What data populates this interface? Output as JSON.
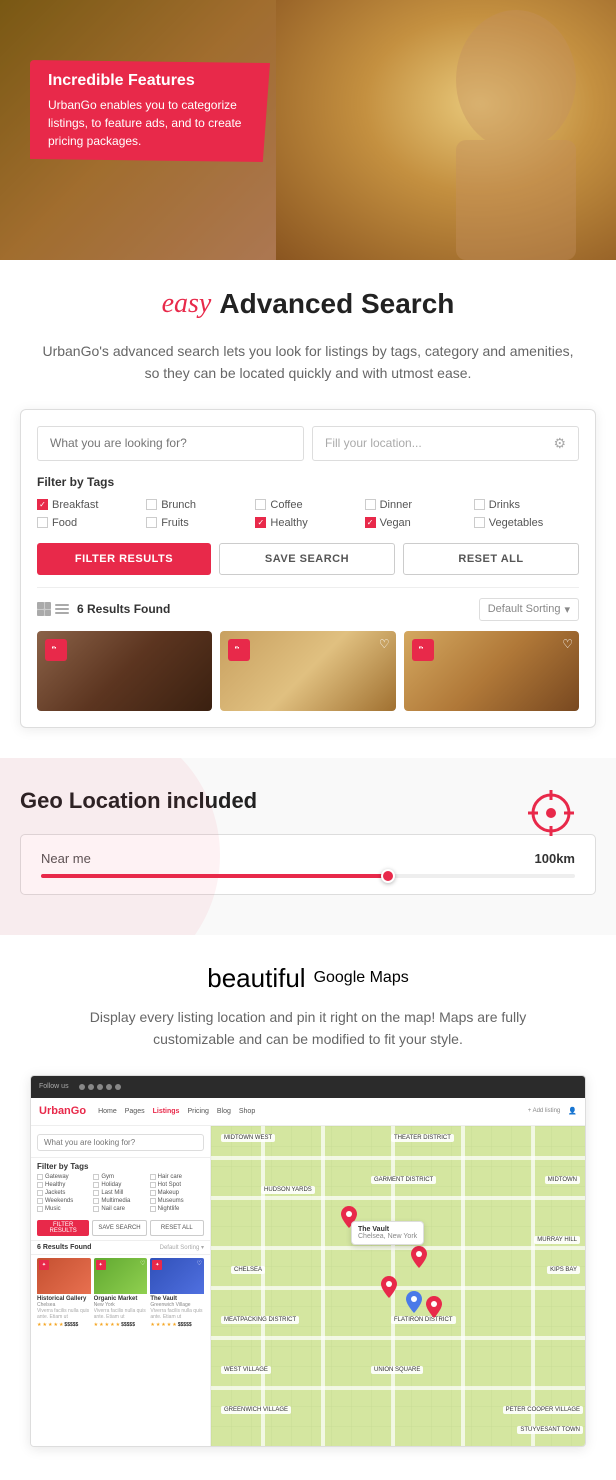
{
  "hero": {
    "badge_title": "Incredible Features",
    "badge_text": "UrbanGo enables you to categorize listings, to feature ads, and to create pricing packages."
  },
  "advanced_search": {
    "section_script": "easy",
    "section_title": "Advanced Search",
    "subtitle": "UrbanGo's advanced search lets you look for listings by tags, category and amenities, so they can be located quickly and with utmost ease.",
    "search_placeholder": "What you are looking for?",
    "location_placeholder": "Fill your location...",
    "filter_label": "Filter by Tags",
    "tags": [
      {
        "label": "Breakfast",
        "checked": true
      },
      {
        "label": "Brunch",
        "checked": false
      },
      {
        "label": "Coffee",
        "checked": false
      },
      {
        "label": "Dinner",
        "checked": false
      },
      {
        "label": "Drinks",
        "checked": false
      },
      {
        "label": "Food",
        "checked": false
      },
      {
        "label": "Fruits",
        "checked": false
      },
      {
        "label": "Healthy",
        "checked": true
      },
      {
        "label": "Vegan",
        "checked": true
      },
      {
        "label": "Vegetables",
        "checked": false
      }
    ],
    "btn_filter": "FILTER RESULTS",
    "btn_save": "SAVE SEARCH",
    "btn_reset": "RESET ALL",
    "results_count": "6 Results Found",
    "sort_label": "Default Sorting"
  },
  "geo": {
    "title": "Geo Location included",
    "near_me_label": "Near me",
    "distance_value": "100km",
    "slider_percent": 65
  },
  "maps": {
    "section_script": "beautiful",
    "section_title": "Google Maps",
    "subtitle": "Display every listing location and pin it right on the map! Maps are fully customizable and can be modified to fit your style.",
    "nav_items": [
      "Home",
      "Pages",
      "Listings",
      "Pricing",
      "Blog",
      "Shop"
    ],
    "active_nav": "Listings",
    "logo": "UrbanGo",
    "add_listing": "+ Add listing",
    "results_count": "6 Results Found",
    "sort_label": "Default Sorting",
    "filter_label": "Filter by Tags",
    "search_placeholder": "What you are looking for?",
    "btn_filter": "FILTER RESULTS",
    "btn_save": "SAVE SEARCH",
    "btn_reset": "RESET ALL",
    "listings": [
      {
        "title": "Historical Gallery",
        "location": "Chelsea",
        "price": "$$$$$"
      },
      {
        "title": "Organic Market",
        "location": "New York",
        "price": "$$$$$"
      },
      {
        "title": "The Vault",
        "location": "Greenwich Village",
        "price": "$$$$$"
      }
    ],
    "map_labels": [
      "MIDTOWN WEST",
      "THEATER DISTRICT",
      "GARMENT DISTRICT",
      "MIDTOWN",
      "MURRAY HILL",
      "HUDSON YARDS",
      "CHELSEA",
      "KIPS BAY",
      "MEATPACKING DISTRICT",
      "FLATIRON DISTRICT",
      "WEST VILLAGE",
      "UNION SQUARE",
      "GREENWICH VILLAGE",
      "PETER COOPER VILLAGE",
      "STUYVESANT TOWN"
    ]
  }
}
